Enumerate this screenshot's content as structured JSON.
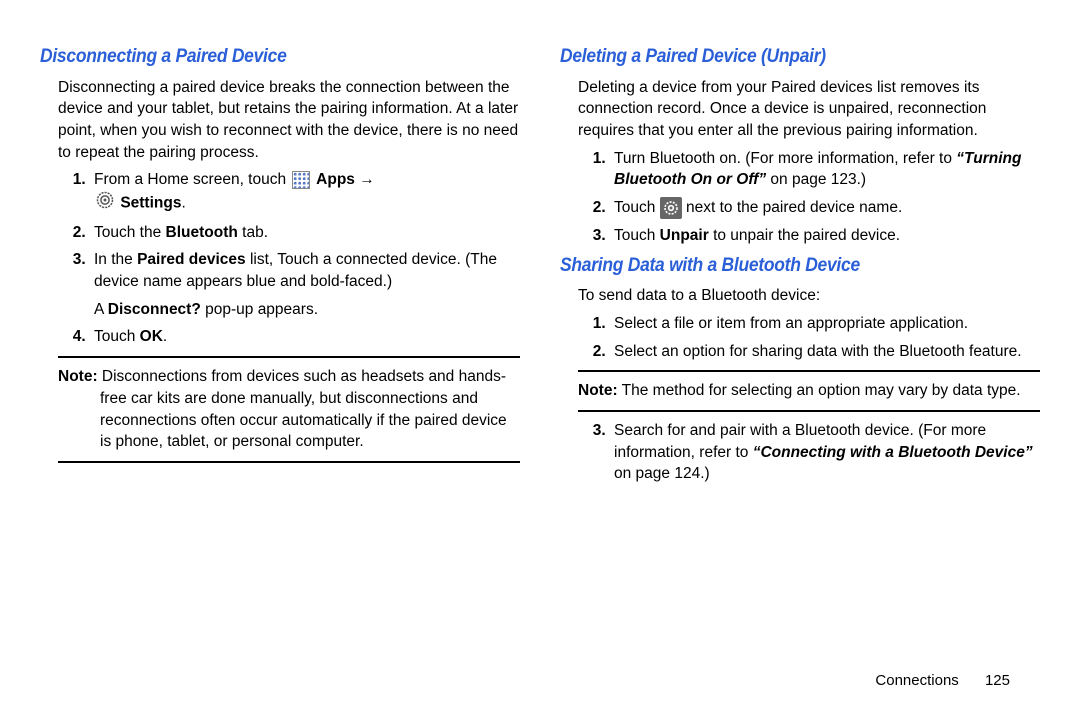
{
  "left": {
    "heading": "Disconnecting a Paired Device",
    "intro": "Disconnecting a paired device breaks the connection between the device and your tablet, but retains the pairing information. At a later point, when you wish to reconnect with the device, there is no need to repeat the pairing process.",
    "step1_pre": "From a Home screen, touch ",
    "step1_apps": "Apps",
    "step1_settings": "Settings",
    "step2_pre": "Touch the ",
    "step2_bold": "Bluetooth",
    "step2_post": " tab.",
    "step3_pre": "In the ",
    "step3_bold": "Paired devices",
    "step3_post": " list, Touch a connected device. (The device name appears blue and bold-faced.)",
    "step3_after_pre": "A ",
    "step3_after_bold": "Disconnect?",
    "step3_after_post": " pop-up appears.",
    "step4_pre": "Touch ",
    "step4_bold": "OK",
    "step4_post": ".",
    "note_label": "Note:",
    "note_text": " Disconnections from devices such as headsets and hands-free car kits are done manually, but disconnections and reconnections often occur automatically if the paired device is phone, tablet, or personal computer."
  },
  "right": {
    "heading1": "Deleting a Paired Device (Unpair)",
    "intro1": "Deleting a device from your Paired devices list removes its connection record. Once a device is unpaired, reconnection requires that you enter all the previous pairing information.",
    "r1_step1_pre": "Turn Bluetooth on. (For more information, refer to ",
    "r1_step1_ref": "“Turning Bluetooth On or Off”",
    "r1_step1_post": " on page 123.)",
    "r1_step2_pre": "Touch ",
    "r1_step2_post": " next to the paired device name.",
    "r1_step3_pre": "Touch ",
    "r1_step3_bold": "Unpair",
    "r1_step3_post": " to unpair the paired device.",
    "heading2": "Sharing Data with a Bluetooth Device",
    "intro2": "To send data to a Bluetooth device:",
    "r2_step1": "Select a file or item from an appropriate application.",
    "r2_step2": "Select an option for sharing data with the Bluetooth feature.",
    "note2_label": "Note:",
    "note2_text": " The method for selecting an option may vary by data type.",
    "r2_step3_pre": "Search for and pair with a Bluetooth device. (For more information, refer to ",
    "r2_step3_ref": "“Connecting with a Bluetooth Device”",
    "r2_step3_post": " on page 124.)"
  },
  "footer": {
    "chapter": "Connections",
    "page": "125"
  }
}
